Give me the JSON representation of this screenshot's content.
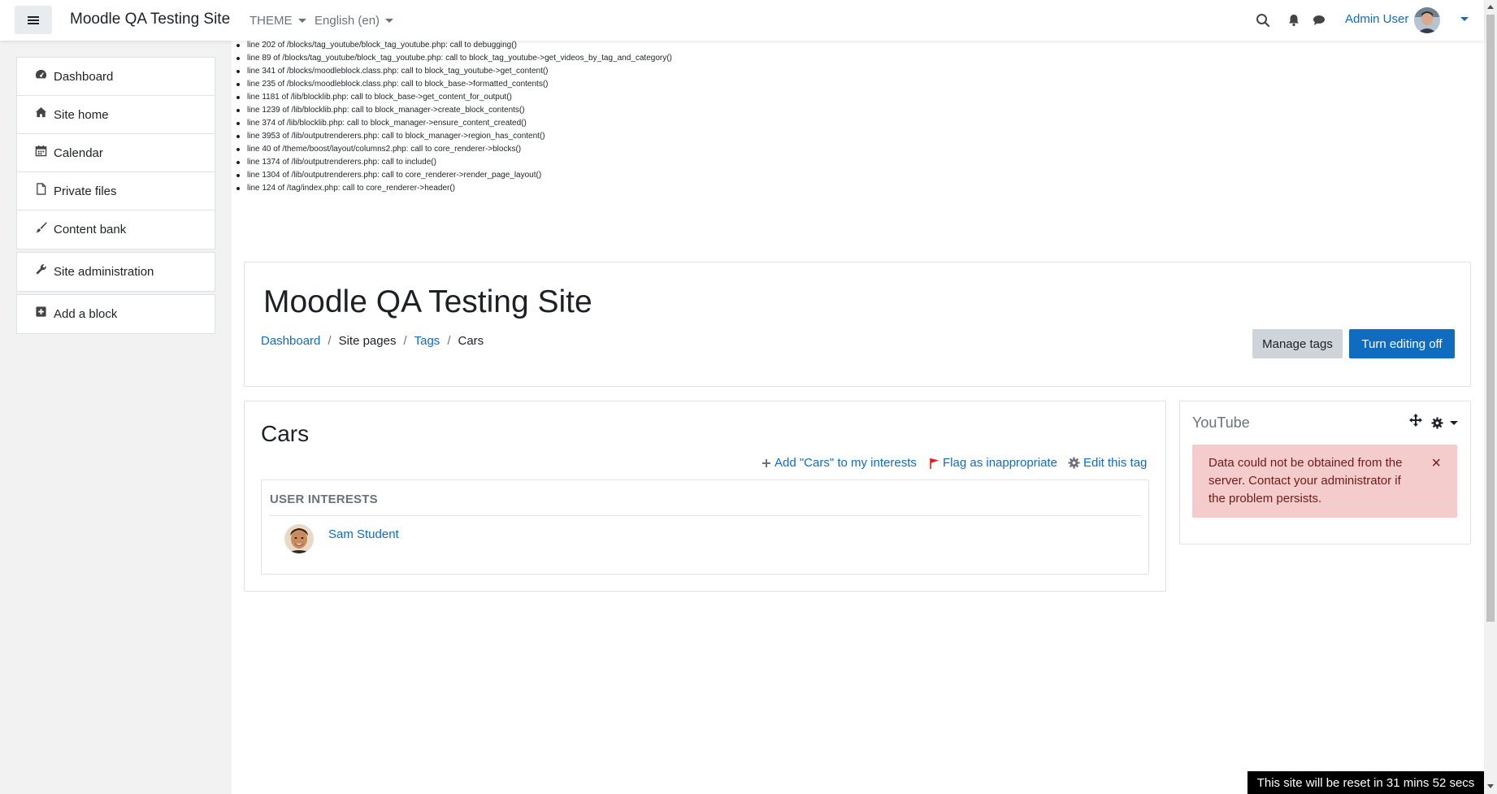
{
  "navbar": {
    "site_name": "Moodle QA Testing Site",
    "theme_label": "THEME",
    "language_label": "English (en)",
    "user_name": "Admin User"
  },
  "sidebar": {
    "group1": [
      {
        "label": "Dashboard",
        "icon": "dashboard-icon"
      },
      {
        "label": "Site home",
        "icon": "home-icon"
      },
      {
        "label": "Calendar",
        "icon": "calendar-icon"
      },
      {
        "label": "Private files",
        "icon": "file-icon"
      },
      {
        "label": "Content bank",
        "icon": "brush-icon"
      }
    ],
    "site_admin": {
      "label": "Site administration",
      "icon": "wrench-icon"
    },
    "add_block": {
      "label": "Add a block",
      "icon": "plus-square-icon"
    }
  },
  "debug": [
    "line 202 of /blocks/tag_youtube/block_tag_youtube.php: call to debugging()",
    "line 89 of /blocks/tag_youtube/block_tag_youtube.php: call to block_tag_youtube->get_videos_by_tag_and_category()",
    "line 341 of /blocks/moodleblock.class.php: call to block_tag_youtube->get_content()",
    "line 235 of /blocks/moodleblock.class.php: call to block_base->formatted_contents()",
    "line 1181 of /lib/blocklib.php: call to block_base->get_content_for_output()",
    "line 1239 of /lib/blocklib.php: call to block_manager->create_block_contents()",
    "line 374 of /lib/blocklib.php: call to block_manager->ensure_content_created()",
    "line 3953 of /lib/outputrenderers.php: call to block_manager->region_has_content()",
    "line 40 of /theme/boost/layout/columns2.php: call to core_renderer->blocks()",
    "line 1374 of /lib/outputrenderers.php: call to include()",
    "line 1304 of /lib/outputrenderers.php: call to core_renderer->render_page_layout()",
    "line 124 of /tag/index.php: call to core_renderer->header()"
  ],
  "page_header": {
    "title": "Moodle QA Testing Site",
    "breadcrumb": {
      "dashboard": "Dashboard",
      "site_pages": "Site pages",
      "tags": "Tags",
      "current": "Cars",
      "separator": "/"
    },
    "manage_tags_label": "Manage tags",
    "turn_editing_off_label": "Turn editing off"
  },
  "tag": {
    "name": "Cars",
    "add_interest_label": "Add \"Cars\" to my interests",
    "flag_label": "Flag as inappropriate",
    "edit_label": "Edit this tag",
    "user_interests_heading": "USER INTERESTS",
    "users": [
      "Sam Student"
    ]
  },
  "youtube_block": {
    "title": "YouTube",
    "alert_text": "Data could not be obtained from the server. Contact your administrator if the problem persists.",
    "close_symbol": "×"
  },
  "reset_banner": "This site will be reset in 31 mins 52 secs",
  "colors": {
    "primary": "#0f6cbf",
    "alert_bg": "#f4cccc",
    "flag": "#e02020"
  }
}
